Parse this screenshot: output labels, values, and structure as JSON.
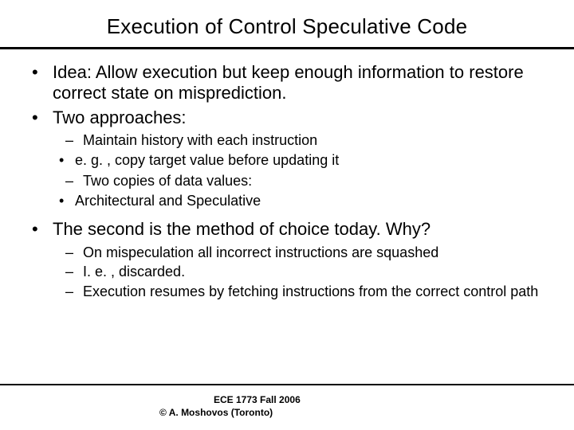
{
  "title": "Execution of Control Speculative Code",
  "bullets": {
    "b1": "Idea: Allow execution but keep enough information to restore correct state on misprediction.",
    "b2": "Two approaches:",
    "b2_1": "Maintain history with each instruction",
    "b2_1_1": "e. g. , copy target value before updating it",
    "b2_2": "Two copies of data values:",
    "b2_2_1": "Architectural and Speculative",
    "b3": "The second is the method of choice today. Why?",
    "b3_1": "On mispeculation all incorrect instructions are squashed",
    "b3_2": "I. e. , discarded.",
    "b3_3": "Execution resumes by fetching instructions from the correct control path"
  },
  "glyphs": {
    "disc": "•",
    "dash": "–"
  },
  "footer": {
    "course": "ECE 1773 Fall 2006",
    "copyright": "© A. Moshovos (Toronto)"
  }
}
